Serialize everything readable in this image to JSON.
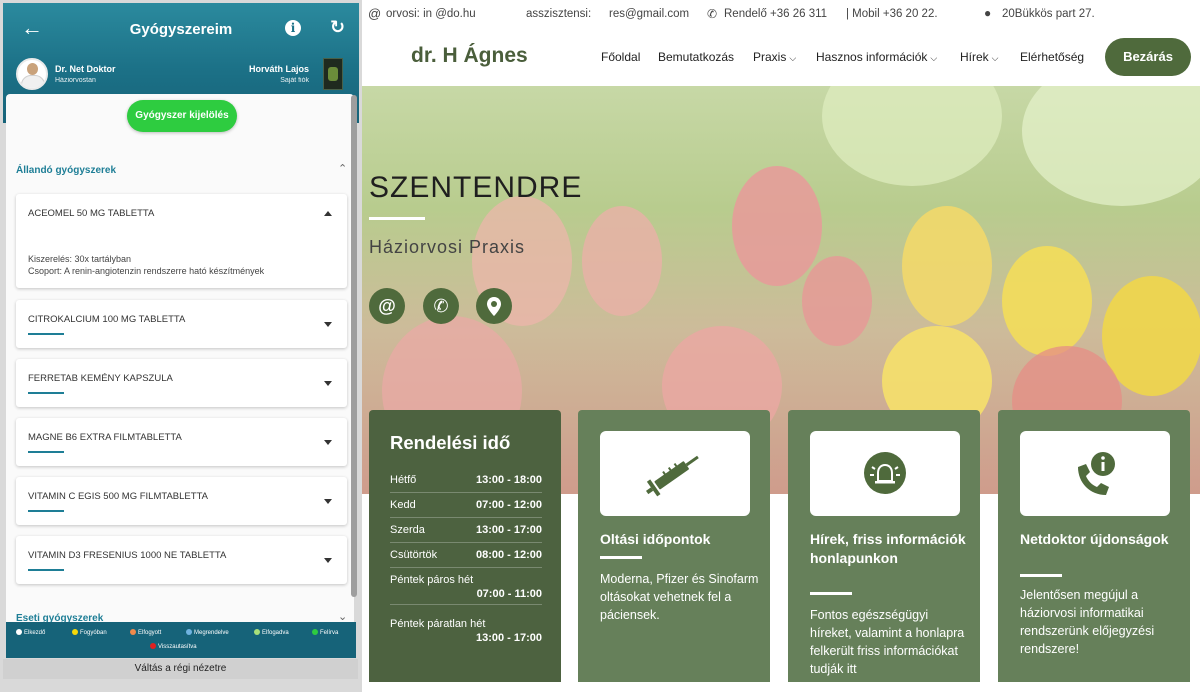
{
  "app": {
    "title": "Gyógyszereim",
    "back_icon": "arrow-left-icon",
    "info_icon": "info-icon",
    "refresh_icon": "refresh-icon",
    "doctor": {
      "name": "Dr. Net Doktor",
      "role": "Háziorvostan"
    },
    "patient": {
      "name": "Horváth Lajos",
      "role": "Saját fiók"
    },
    "select_button": "Gyógyszer kijelölés",
    "section_permanent": "Állandó gyógyszerek",
    "section_temporary": "Eseti gyógyszerek",
    "medications": [
      {
        "name": "ACEOMEL 50 MG TABLETTA",
        "expanded": true,
        "packaging": "Kiszerelés: 30x tartályban",
        "group": "Csoport: A renin-angiotenzin rendszerre ható készítmények"
      },
      {
        "name": "CITROKALCIUM 100 MG TABLETTA",
        "expanded": false
      },
      {
        "name": "FERRETAB KEMÉNY KAPSZULA",
        "expanded": false
      },
      {
        "name": "MAGNE B6 EXTRA FILMTABLETTA",
        "expanded": false
      },
      {
        "name": "VITAMIN C EGIS 500 MG FILMTABLETTA",
        "expanded": false
      },
      {
        "name": "VITAMIN D3 FRESENIUS 1000 NE TABLETTA",
        "expanded": false
      }
    ],
    "legend": [
      {
        "label": "Elkezdő",
        "color": "#ffffff"
      },
      {
        "label": "Fogyóban",
        "color": "#f5d90a"
      },
      {
        "label": "Elfogyott",
        "color": "#f08a4b"
      },
      {
        "label": "Megrendelve",
        "color": "#6fb3e0"
      },
      {
        "label": "Elfogadva",
        "color": "#a8e07a"
      },
      {
        "label": "Felírva",
        "color": "#2ecc40"
      },
      {
        "label": "Visszautasítva",
        "color": "#e02020"
      }
    ],
    "old_view_link": "Váltás a régi nézetre",
    "colors": {
      "header": "#1c7187",
      "accent": "#1e7e96",
      "button": "#2ecc40"
    }
  },
  "site": {
    "topbar": {
      "email_icon": "at-icon",
      "email": "orvosi: in @do.hu",
      "assistant": "asszisztensi:",
      "assistant_email": "res@gmail.com",
      "phone_icon": "phone-icon",
      "phone": "Rendelő +36 26 311",
      "mobile": "| Mobil +36 20 22.",
      "location_icon": "location-pin-icon",
      "address": "20Bükkös part 27."
    },
    "logo": "dr. H  Ágnes",
    "nav": [
      {
        "label": "Főoldal",
        "active": true,
        "dropdown": false
      },
      {
        "label": "Bemutatkozás",
        "active": false,
        "dropdown": false
      },
      {
        "label": "Praxis",
        "active": false,
        "dropdown": true
      },
      {
        "label": "Hasznos információk",
        "active": false,
        "dropdown": true
      },
      {
        "label": "Hírek",
        "active": false,
        "dropdown": true
      },
      {
        "label": "Elérhetőség",
        "active": false,
        "dropdown": false
      }
    ],
    "close_button": "Bezárás",
    "hero": {
      "title": "SZENTENDRE",
      "subtitle": "Háziorvosi Praxis",
      "icons": [
        "at-icon",
        "phone-icon",
        "location-pin-icon"
      ]
    },
    "hours": {
      "title": "Rendelési idő",
      "rows": [
        {
          "day": "Hétfő",
          "time": "13:00 - 18:00"
        },
        {
          "day": "Kedd",
          "time": "07:00 - 12:00"
        },
        {
          "day": "Szerda",
          "time": "13:00 - 17:00"
        },
        {
          "day": "Csütörtök",
          "time": "08:00 - 12:00"
        },
        {
          "day": "Péntek páros hét",
          "time": "07:00 - 11:00"
        },
        {
          "day": "Péntek páratlan hét",
          "time": "13:00 - 17:00"
        }
      ]
    },
    "cards": [
      {
        "icon": "syringe-icon",
        "title": "Oltási időpontok",
        "text": "Moderna, Pfizer és Sinofarm oltásokat vehetnek fel a páciensek."
      },
      {
        "icon": "alarm-bell-icon",
        "title": "Hírek, friss információk honlapunkon",
        "text": "Fontos egészségügyi híreket, valamint a honlapra felkerült friss információkat tudják itt"
      },
      {
        "icon": "phone-info-icon",
        "title": "Netdoktor újdonságok",
        "text": "Jelentősen megújul a háziorvosi informatikai rendszerünk előjegyzési rendszere!"
      }
    ],
    "colors": {
      "brand": "#4f6a3c",
      "card": "#66805a",
      "hours_card": "#4d6240"
    }
  }
}
